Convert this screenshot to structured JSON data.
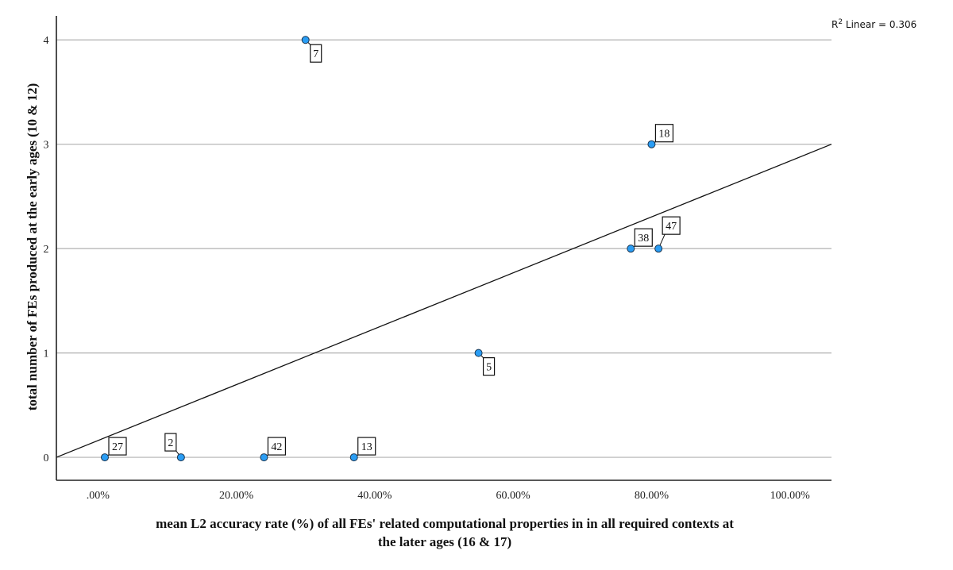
{
  "chart_data": {
    "type": "scatter",
    "title": "",
    "xlabel_lines": [
      "mean L2 accuracy rate (%) of all FEs' related computational properties in in all required contexts at",
      "the later ages (16 & 17)"
    ],
    "ylabel": "total number of FEs produced at the early ages (10 & 12)",
    "xlim": [
      -6,
      106
    ],
    "ylim": [
      -0.22,
      4.23
    ],
    "x_ticks": [
      0,
      20,
      40,
      60,
      80,
      100
    ],
    "x_tick_labels": [
      ".00%",
      "20.00%",
      "40.00%",
      "60.00%",
      "80.00%",
      "100.00%"
    ],
    "y_ticks": [
      0,
      1,
      2,
      3,
      4
    ],
    "y_tick_labels": [
      "0",
      "1",
      "2",
      "3",
      "4"
    ],
    "grid": "horizontal",
    "points": [
      {
        "id": "7",
        "x": 30,
        "y": 4,
        "label_pos": "below-right"
      },
      {
        "id": "18",
        "x": 80,
        "y": 3,
        "label_pos": "above-right"
      },
      {
        "id": "38",
        "x": 77,
        "y": 2,
        "label_pos": "above-right"
      },
      {
        "id": "47",
        "x": 81,
        "y": 2,
        "label_pos": "above-right-far"
      },
      {
        "id": "5",
        "x": 55,
        "y": 1,
        "label_pos": "below-right"
      },
      {
        "id": "27",
        "x": 1,
        "y": 0,
        "label_pos": "above-right"
      },
      {
        "id": "2",
        "x": 12,
        "y": 0,
        "label_pos": "above-left"
      },
      {
        "id": "42",
        "x": 24,
        "y": 0,
        "label_pos": "above-right"
      },
      {
        "id": "13",
        "x": 37,
        "y": 0,
        "label_pos": "above-right"
      }
    ],
    "fit_line": {
      "type": "linear",
      "x": [
        -6,
        106
      ],
      "y": [
        0,
        3.0
      ]
    },
    "r2_label": {
      "prefix": "R",
      "sup": "2",
      "text": " Linear = 0.306"
    },
    "colors": {
      "point": "#2a9df4",
      "point_stroke": "#1a3550",
      "grid": "#b0b0b0",
      "axis": "#222222",
      "fit": "#111111"
    }
  }
}
